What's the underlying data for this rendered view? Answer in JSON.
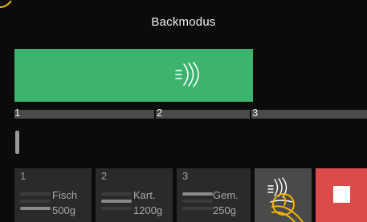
{
  "header": {
    "title": "Backmodus"
  },
  "program": {
    "segment_numbers": [
      "1",
      "2",
      "3"
    ],
    "current_segment": 1,
    "heating_icon": "steam-icon"
  },
  "steps": [
    {
      "number": "1",
      "name": "Fisch",
      "weight": "500g"
    },
    {
      "number": "2",
      "name": "Kart.",
      "weight": "1200g"
    },
    {
      "number": "3",
      "name": "Gem.",
      "weight": "250g"
    }
  ],
  "controls": {
    "mode_icon": "steam-bake-icon",
    "stop_icon": "stop-icon",
    "touch_hint_icon": "hand-touch-icon"
  },
  "colors": {
    "background": "#0b0b0b",
    "active_progress": "#3cb46e",
    "stop": "#dc4a4a",
    "accent": "#f0b400",
    "tile": "#2a2a2a",
    "track": "#4a4a4a"
  }
}
